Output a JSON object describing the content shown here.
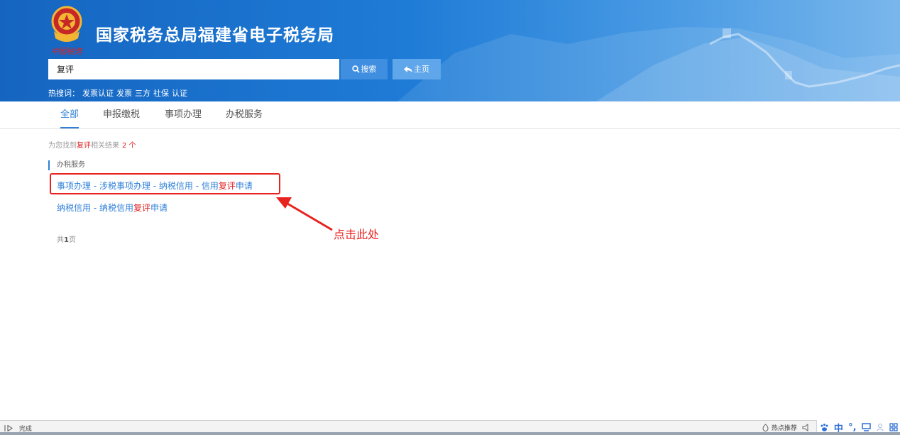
{
  "header": {
    "emblem_text": "中国税务",
    "site_title": "国家税务总局福建省电子税务局",
    "search_value": "复评",
    "search_button": "搜索",
    "home_button": "主页",
    "hot_label": "热搜词：",
    "hot_words": [
      "发票认证",
      "发票",
      "三方",
      "社保",
      "认证"
    ]
  },
  "tabs": [
    "全部",
    "申报缴税",
    "事项办理",
    "办税服务"
  ],
  "summary": {
    "prefix": "为您找到",
    "keyword": "复评",
    "suffix": "相关结果",
    "count": "2 个"
  },
  "section": "办税服务",
  "results": [
    {
      "before": "事项办理 - 涉税事项办理 - 纳税信用 - 信用",
      "keyword": "复评",
      "after": "申请"
    },
    {
      "before": "纳税信用 - 纳税信用",
      "keyword": "复评",
      "after": "申请"
    }
  ],
  "annotation": "点击此处",
  "pager": {
    "pre": "共",
    "num": "1",
    "post": "页"
  },
  "statusbar": {
    "status": "完成",
    "hot_recommend": "热点推荐"
  },
  "ime": {
    "mode": "中",
    "punct": "°,"
  },
  "colors": {
    "header_blue": "#1565c0",
    "link_blue": "#2f80d8",
    "highlight_red": "#e8221f"
  }
}
